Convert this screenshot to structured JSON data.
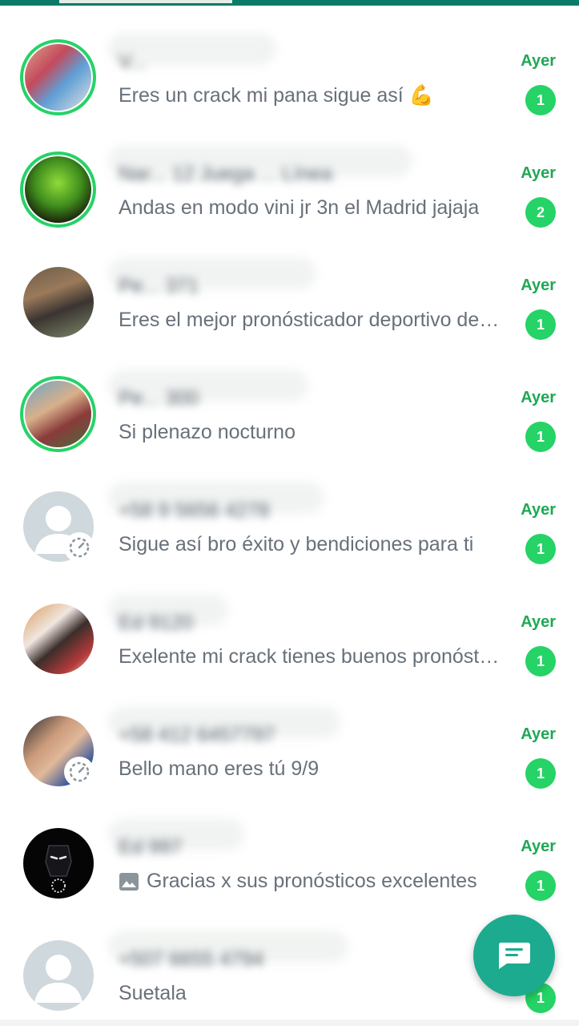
{
  "chats": [
    {
      "name": "V...",
      "message": "Eres un crack mi pana sigue así 💪",
      "time": "Ayer",
      "unread": "1"
    },
    {
      "name": "Nar... 12 Juega ... Línea",
      "message": "Andas en modo vini jr  3n el Madrid jajaja",
      "time": "Ayer",
      "unread": "2"
    },
    {
      "name": "Pe... 371",
      "message": "Eres el mejor pronósticador deportivo del mundo",
      "time": "Ayer",
      "unread": "1"
    },
    {
      "name": "Pe... 300",
      "message": "Si plenazo nocturno",
      "time": "Ayer",
      "unread": "1"
    },
    {
      "name": "+58 9 5656 4278",
      "message": "Sigue así bro éxito y bendiciones para ti",
      "time": "Ayer",
      "unread": "1"
    },
    {
      "name": "Ed 9120",
      "message": "Exelente mi crack  tienes buenos pronósticos",
      "time": "Ayer",
      "unread": "1"
    },
    {
      "name": "+58 412 6457797",
      "message": "Bello mano eres tú 9/9",
      "time": "Ayer",
      "unread": "1"
    },
    {
      "name": "Ed 997",
      "message": "Gracias x sus pronósticos excelentes",
      "time": "Ayer",
      "unread": "1"
    },
    {
      "name": "+507 6655 4794",
      "message": "Suetala",
      "time": "",
      "unread": "1"
    }
  ],
  "icons": {
    "new_chat": "chat-icon",
    "status_pending": "status-pending-icon",
    "photo": "photo-icon"
  },
  "colors": {
    "accent": "#25d366",
    "header": "#0a7b67",
    "fab": "#1dab8f"
  }
}
